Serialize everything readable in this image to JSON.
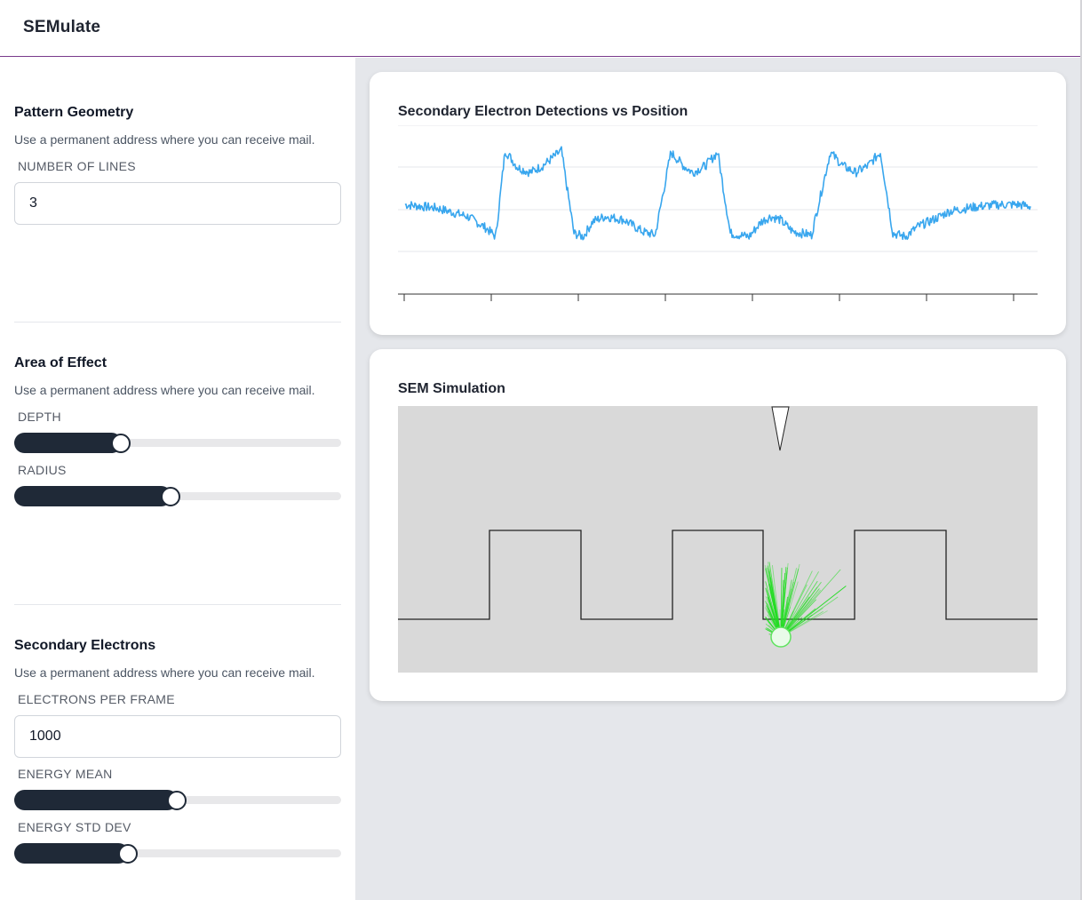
{
  "app": {
    "title": "SEMulate"
  },
  "sidebar": {
    "pattern_geometry": {
      "title": "Pattern Geometry",
      "description": "Use a permanent address where you can receive mail.",
      "number_of_lines_label": "NUMBER OF LINES",
      "number_of_lines_value": "3"
    },
    "area_of_effect": {
      "title": "Area of Effect",
      "description": "Use a permanent address where you can receive mail.",
      "depth_label": "DEPTH",
      "depth_value": 0.3,
      "radius_label": "RADIUS",
      "radius_value": 0.45
    },
    "secondary_electrons": {
      "title": "Secondary Electrons",
      "description": "Use a permanent address where you can receive mail.",
      "electrons_per_frame_label": "ELECTRONS PER FRAME",
      "electrons_per_frame_value": "1000",
      "energy_mean_label": "ENERGY MEAN",
      "energy_mean_value": 0.47,
      "energy_std_dev_label": "ENERGY STD DEV",
      "energy_std_dev_value": 0.32
    }
  },
  "detections_card": {
    "title": "Secondary Electron Detections vs Position"
  },
  "simulation_card": {
    "title": "SEM Simulation",
    "colors": {
      "background": "#d9d9d9",
      "profile": "#222222",
      "electrons": "#22dd22"
    }
  },
  "chart_data": {
    "type": "line",
    "title": "Secondary Electron Detections vs Position",
    "xlabel": "",
    "ylabel": "",
    "xlim": [
      0,
      1
    ],
    "ylim": [
      0,
      1
    ],
    "grid": true,
    "series": [
      {
        "color": "#38a6ee",
        "x": [
          0.0,
          0.05,
          0.1,
          0.13,
          0.145,
          0.16,
          0.18,
          0.2,
          0.22,
          0.25,
          0.27,
          0.285,
          0.3,
          0.32,
          0.35,
          0.38,
          0.4,
          0.425,
          0.445,
          0.46,
          0.48,
          0.5,
          0.52,
          0.55,
          0.57,
          0.585,
          0.6,
          0.62,
          0.65,
          0.68,
          0.7,
          0.72,
          0.74,
          0.76,
          0.78,
          0.8,
          0.82,
          0.85,
          0.87,
          0.885,
          0.9,
          0.92,
          0.95,
          0.98,
          1.0
        ],
        "y": [
          0.53,
          0.51,
          0.46,
          0.39,
          0.34,
          0.85,
          0.75,
          0.72,
          0.76,
          0.85,
          0.36,
          0.34,
          0.43,
          0.46,
          0.44,
          0.37,
          0.35,
          0.84,
          0.76,
          0.72,
          0.76,
          0.84,
          0.36,
          0.34,
          0.43,
          0.46,
          0.44,
          0.37,
          0.35,
          0.84,
          0.76,
          0.72,
          0.76,
          0.84,
          0.36,
          0.34,
          0.4,
          0.45,
          0.49,
          0.5,
          0.51,
          0.52,
          0.53,
          0.53,
          0.52
        ]
      }
    ]
  }
}
